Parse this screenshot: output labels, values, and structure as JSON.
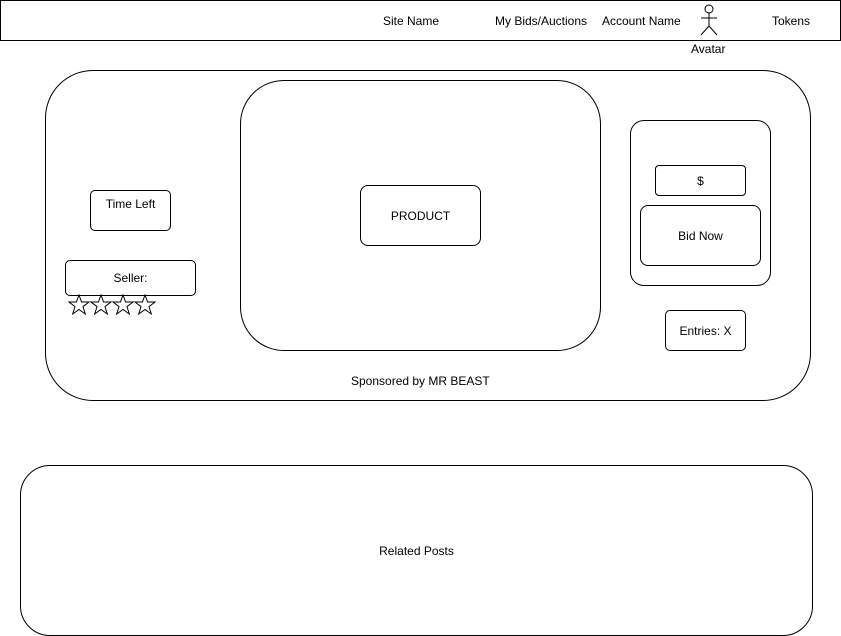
{
  "header": {
    "site_name": "Site Name",
    "my_bids": "My Bids/Auctions",
    "account_name": "Account Name",
    "avatar_label": "Avatar",
    "tokens": "Tokens"
  },
  "auction": {
    "time_left": "Time Left",
    "seller_label": "Seller:",
    "rating_stars": 4,
    "product_label": "PRODUCT",
    "price_field": "$",
    "bid_button": "Bid Now",
    "entries": "Entries: X",
    "sponsor_text": "Sponsored by MR BEAST"
  },
  "related": {
    "label": "Related Posts"
  }
}
